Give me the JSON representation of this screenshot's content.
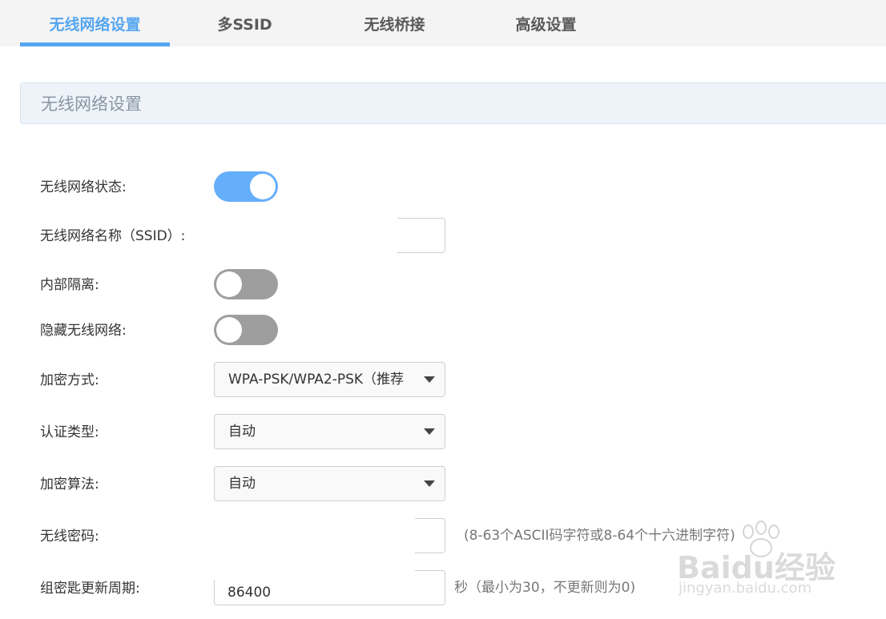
{
  "tabs": [
    {
      "label": "无线网络设置",
      "active": true
    },
    {
      "label": "多SSID",
      "active": false
    },
    {
      "label": "无线桥接",
      "active": false
    },
    {
      "label": "高级设置",
      "active": false
    }
  ],
  "section": {
    "title": "无线网络设置"
  },
  "form": {
    "wireless_status": {
      "label": "无线网络状态:",
      "on": true
    },
    "ssid": {
      "label": "无线网络名称（SSID）:",
      "value": ""
    },
    "isolation": {
      "label": "内部隔离:",
      "on": false
    },
    "hide_network": {
      "label": "隐藏无线网络:",
      "on": false
    },
    "encryption": {
      "label": "加密方式:",
      "value": "WPA-PSK/WPA2-PSK（推荐"
    },
    "auth_type": {
      "label": "认证类型:",
      "value": "自动"
    },
    "algorithm": {
      "label": "加密算法:",
      "value": "自动"
    },
    "password": {
      "label": "无线密码:",
      "value": "",
      "hint": "(8-63个ASCII码字符或8-64个十六进制字符)"
    },
    "rekey": {
      "label": "组密匙更新周期:",
      "value": "86400",
      "hint": "秒（最小为30，不更新则为0)"
    }
  },
  "watermark": {
    "line1": "Baidu经验",
    "line2": "jingyan.baidu.com"
  },
  "colors": {
    "accent": "#55a6f0",
    "toggle_on": "#65aefb",
    "toggle_off": "#9e9e9e"
  }
}
